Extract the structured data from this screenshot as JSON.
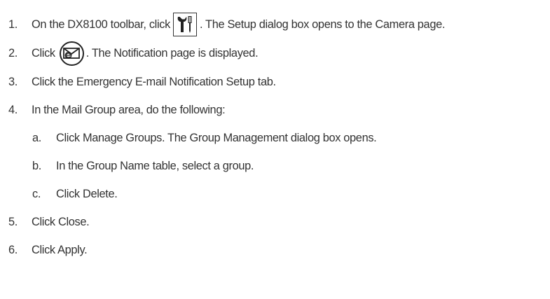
{
  "steps": [
    {
      "num": "1.",
      "before": "On the DX8100 toolbar, click",
      "icon": "setup-tools-icon",
      "after": ". The Setup dialog box opens to the Camera page."
    },
    {
      "num": "2.",
      "before": "Click",
      "icon": "email-notification-icon",
      "after": ". The Notification page is displayed."
    },
    {
      "num": "3.",
      "text": "Click the Emergency E-mail Notification Setup tab."
    },
    {
      "num": "4.",
      "text": "In the Mail Group area, do the following:"
    },
    {
      "num": "5.",
      "text": "Click Close."
    },
    {
      "num": "6.",
      "text": "Click Apply."
    }
  ],
  "substeps": [
    {
      "num": "a.",
      "text": "Click Manage Groups. The Group Management dialog box opens."
    },
    {
      "num": "b.",
      "text": "In the Group Name table, select a group."
    },
    {
      "num": "c.",
      "text": "Click Delete."
    }
  ]
}
